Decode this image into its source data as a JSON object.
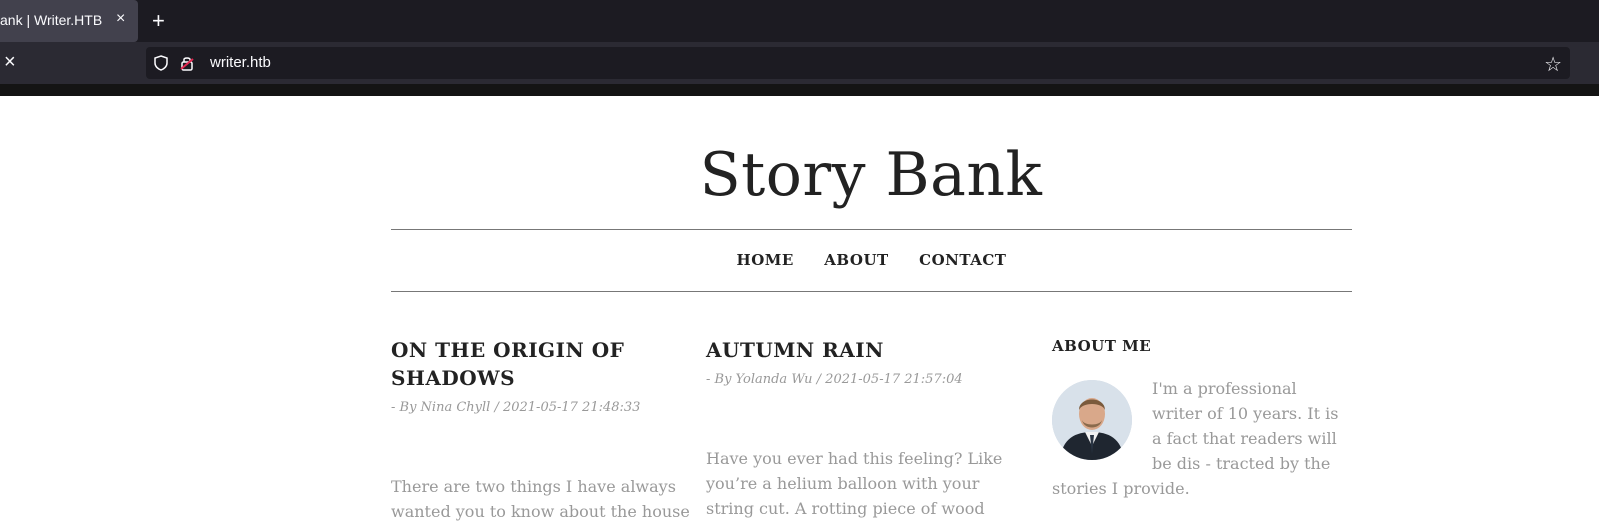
{
  "browser": {
    "tab_title": "ank | Writer.HTB",
    "tab_close": "×",
    "new_tab": "+",
    "nav_close": "×",
    "url": "writer.htb",
    "bookmark": "☆"
  },
  "site": {
    "title": "Story Bank",
    "menu": [
      "HOME",
      "ABOUT",
      "CONTACT"
    ]
  },
  "posts": [
    {
      "title_line1": "ON THE ORIGIN OF",
      "title_line2": "SHADOWS",
      "meta": "- By Nina Chyll / 2021-05-17 21:48:33",
      "body_line1": "There are two things I have always",
      "body_line2": "wanted you to know about the house"
    },
    {
      "title_line1": "AUTUMN RAIN",
      "meta": "- By Yolanda Wu / 2021-05-17 21:57:04",
      "body_line1": "Have you ever had this feeling? Like",
      "body_line2": "you’re a helium balloon with your",
      "body_line3": "string cut. A rotting piece of wood"
    }
  ],
  "about": {
    "heading": "ABOUT ME",
    "text": "I'm a professional writer of 10 years. It is a fact that readers will be dis - tracted by the stories I provide."
  }
}
